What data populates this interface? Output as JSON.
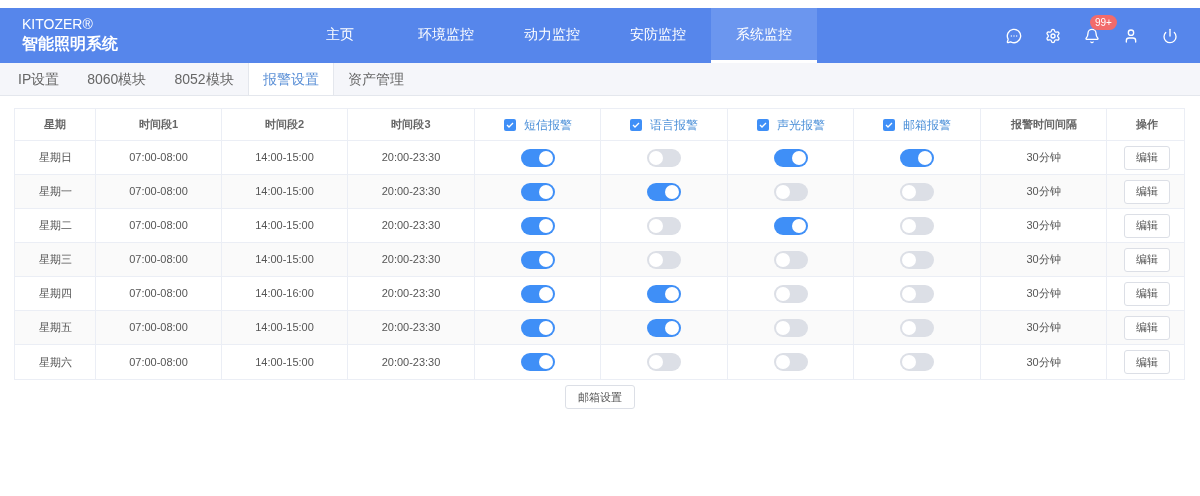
{
  "brand": {
    "name": "KITOZER®",
    "title": "智能照明系统"
  },
  "nav": [
    {
      "label": "主页",
      "selected": false
    },
    {
      "label": "环境监控",
      "selected": false
    },
    {
      "label": "动力监控",
      "selected": false
    },
    {
      "label": "安防监控",
      "selected": false
    },
    {
      "label": "系统监控",
      "selected": true
    }
  ],
  "notifications": {
    "badge": "99+"
  },
  "tabs": [
    {
      "label": "IP设置",
      "selected": false
    },
    {
      "label": "8060模块",
      "selected": false
    },
    {
      "label": "8052模块",
      "selected": false
    },
    {
      "label": "报警设置",
      "selected": true
    },
    {
      "label": "资产管理",
      "selected": false
    }
  ],
  "table": {
    "columns": [
      {
        "label": "星期",
        "kind": "text"
      },
      {
        "label": "时间段1",
        "kind": "text"
      },
      {
        "label": "时间段2",
        "kind": "text"
      },
      {
        "label": "时间段3",
        "kind": "text"
      },
      {
        "label": "短信报警",
        "kind": "check",
        "checked": true
      },
      {
        "label": "语言报警",
        "kind": "check",
        "checked": true
      },
      {
        "label": "声光报警",
        "kind": "check",
        "checked": true
      },
      {
        "label": "邮箱报警",
        "kind": "check",
        "checked": true
      },
      {
        "label": "报警时间间隔",
        "kind": "text"
      },
      {
        "label": "操作",
        "kind": "text"
      }
    ],
    "rows": [
      {
        "day": "星期日",
        "t1": "07:00-08:00",
        "t2": "14:00-15:00",
        "t3": "20:00-23:30",
        "alarms": [
          {
            "on": true
          },
          {
            "on": false
          },
          {
            "on": true
          },
          {
            "on": true
          }
        ],
        "interval": "30分钟",
        "action": "编辑"
      },
      {
        "day": "星期一",
        "t1": "07:00-08:00",
        "t2": "14:00-15:00",
        "t3": "20:00-23:30",
        "alarms": [
          {
            "on": true
          },
          {
            "on": true
          },
          {
            "on": false
          },
          {
            "on": false
          }
        ],
        "interval": "30分钟",
        "action": "编辑"
      },
      {
        "day": "星期二",
        "t1": "07:00-08:00",
        "t2": "14:00-15:00",
        "t3": "20:00-23:30",
        "alarms": [
          {
            "on": true
          },
          {
            "on": false
          },
          {
            "on": true
          },
          {
            "on": false
          }
        ],
        "interval": "30分钟",
        "action": "编辑"
      },
      {
        "day": "星期三",
        "t1": "07:00-08:00",
        "t2": "14:00-15:00",
        "t3": "20:00-23:30",
        "alarms": [
          {
            "on": true
          },
          {
            "on": false
          },
          {
            "on": false
          },
          {
            "on": false
          }
        ],
        "interval": "30分钟",
        "action": "编辑"
      },
      {
        "day": "星期四",
        "t1": "07:00-08:00",
        "t2": "14:00-16:00",
        "t3": "20:00-23:30",
        "alarms": [
          {
            "on": true
          },
          {
            "on": true
          },
          {
            "on": false
          },
          {
            "on": false
          }
        ],
        "interval": "30分钟",
        "action": "编辑"
      },
      {
        "day": "星期五",
        "t1": "07:00-08:00",
        "t2": "14:00-15:00",
        "t3": "20:00-23:30",
        "alarms": [
          {
            "on": true
          },
          {
            "on": true
          },
          {
            "on": false
          },
          {
            "on": false
          }
        ],
        "interval": "30分钟",
        "action": "编辑"
      },
      {
        "day": "星期六",
        "t1": "07:00-08:00",
        "t2": "14:00-15:00",
        "t3": "20:00-23:30",
        "alarms": [
          {
            "on": true
          },
          {
            "on": false
          },
          {
            "on": false
          },
          {
            "on": false
          }
        ],
        "interval": "30分钟",
        "action": "编辑"
      }
    ]
  },
  "footer_button": "邮箱设置"
}
